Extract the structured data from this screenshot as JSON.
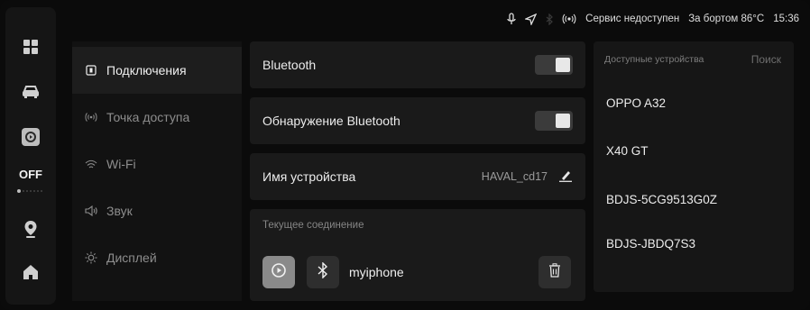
{
  "status": {
    "service_text": "Сервис недоступен",
    "outside_temp": "За бортом 86°C",
    "time": "15:36"
  },
  "dock": {
    "off_label": "OFF",
    "icons": [
      "apps-grid-icon",
      "car-icon",
      "media-player-icon",
      "location-pin-icon",
      "home-icon"
    ]
  },
  "menu": {
    "items": [
      {
        "label": "Подключения",
        "icon": "connection-icon",
        "active": true
      },
      {
        "label": "Точка доступа",
        "icon": "hotspot-icon",
        "active": false
      },
      {
        "label": "Wi-Fi",
        "icon": "wifi-icon",
        "active": false
      },
      {
        "label": "Звук",
        "icon": "speaker-icon",
        "active": false
      },
      {
        "label": "Дисплей",
        "icon": "brightness-icon",
        "active": false
      }
    ]
  },
  "bluetooth": {
    "label": "Bluetooth",
    "enabled": true,
    "discovery_label": "Обнаружение Bluetooth",
    "discovery_enabled": true,
    "device_name_label": "Имя устройства",
    "device_name_value": "HAVAL_cd17"
  },
  "connection": {
    "title": "Текущее соединение",
    "device_name": "myiphone"
  },
  "available": {
    "title": "Доступные устройства",
    "search_label": "Поиск",
    "devices": [
      "OPPO A32",
      "X40 GT",
      "BDJS-5CG9513G0Z",
      "BDJS-JBDQ7S3"
    ]
  },
  "colors": {
    "background": "#0b0b0b",
    "panel": "#1a1a1a",
    "active_menu": "#1d1d1d",
    "text_primary": "#ececec",
    "text_muted": "#8d8d8d"
  }
}
